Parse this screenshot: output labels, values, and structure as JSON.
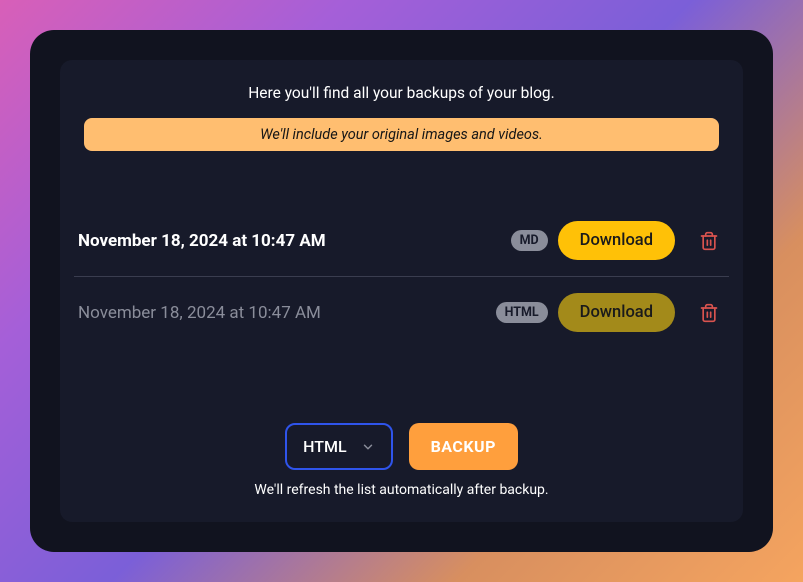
{
  "header": {
    "description": "Here you'll find all your backups of your blog.",
    "notice": "We'll include your original images and videos."
  },
  "backups": [
    {
      "date": "November 18, 2024 at 10:47 AM",
      "format": "MD",
      "download_label": "Download",
      "state": "ready"
    },
    {
      "date": "November 18, 2024 at 10:47 AM",
      "format": "HTML",
      "download_label": "Download",
      "state": "busy"
    }
  ],
  "controls": {
    "selected_format": "HTML",
    "backup_button_label": "BACKUP",
    "hint": "We'll refresh the list automatically after backup."
  },
  "colors": {
    "accent_orange": "#ff9f3d",
    "accent_yellow": "#ffc107",
    "banner": "#ffbe70",
    "select_border": "#2f54eb",
    "trash": "#d9534f"
  }
}
